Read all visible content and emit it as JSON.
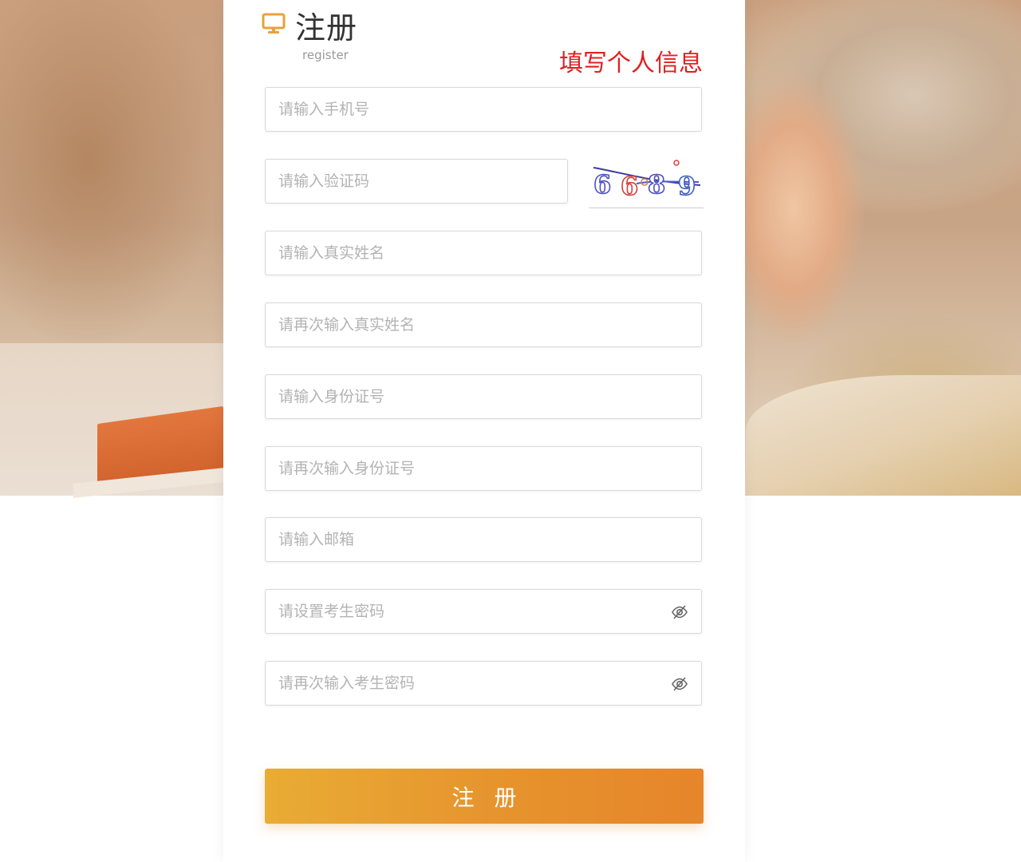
{
  "header": {
    "title": "注册",
    "subtitle": "register",
    "icon": "monitor-icon"
  },
  "annotation": "填写个人信息",
  "form": {
    "phone_placeholder": "请输入手机号",
    "code_placeholder": "请输入验证码",
    "captcha_text": "6689",
    "name_placeholder": "请输入真实姓名",
    "name_confirm_placeholder": "请再次输入真实姓名",
    "idcard_placeholder": "请输入身份证号",
    "idcard_confirm_placeholder": "请再次输入身份证号",
    "email_placeholder": "请输入邮箱",
    "password_placeholder": "请设置考生密码",
    "password_confirm_placeholder": "请再次输入考生密码",
    "submit_label": "注 册"
  },
  "colors": {
    "accent": "#e6932d",
    "icon": "#e8a23a",
    "annotation": "#e02020"
  }
}
